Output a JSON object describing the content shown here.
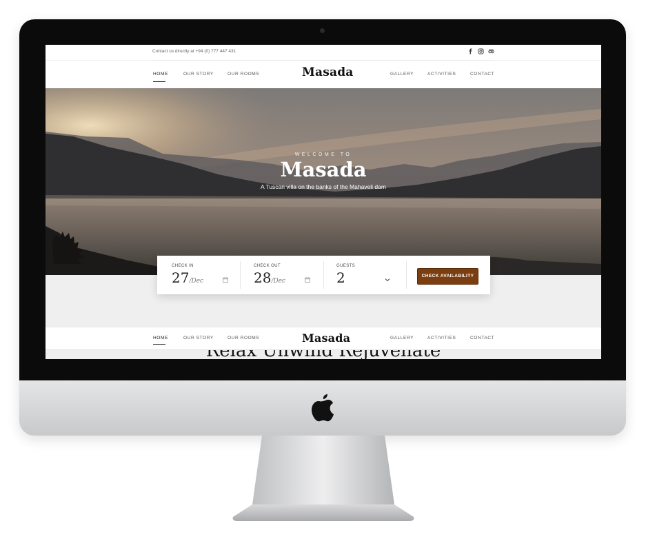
{
  "topbar": {
    "contact": "Contact us directly at +94 (0) 777 447 431",
    "social_icons": [
      "facebook-icon",
      "instagram-icon",
      "tripadvisor-icon"
    ]
  },
  "nav": {
    "brand": "Masada",
    "items": [
      "HOME",
      "OUR STORY",
      "OUR ROOMS",
      "GALLERY",
      "ACTIVITIES",
      "CONTACT"
    ],
    "active": "HOME"
  },
  "hero": {
    "welcome": "WELCOME TO",
    "title": "Masada",
    "subtitle": "A Tuscan villa on the banks of the Mahaveli dam"
  },
  "booking": {
    "check_in_label": "CHECK IN",
    "check_in_day": "27",
    "check_in_month": "/Dec",
    "check_out_label": "CHECK OUT",
    "check_out_day": "28",
    "check_out_month": "/Dec",
    "guests_label": "GUESTS",
    "guests_value": "2",
    "button_label": "CHECK AVAILABILITY"
  },
  "section": {
    "tagline": "Relax Unwind Rejuvenate"
  },
  "colors": {
    "accent": "#7a3e10",
    "bezel": "#0b0b0c",
    "chin": "#d2d3d5"
  }
}
